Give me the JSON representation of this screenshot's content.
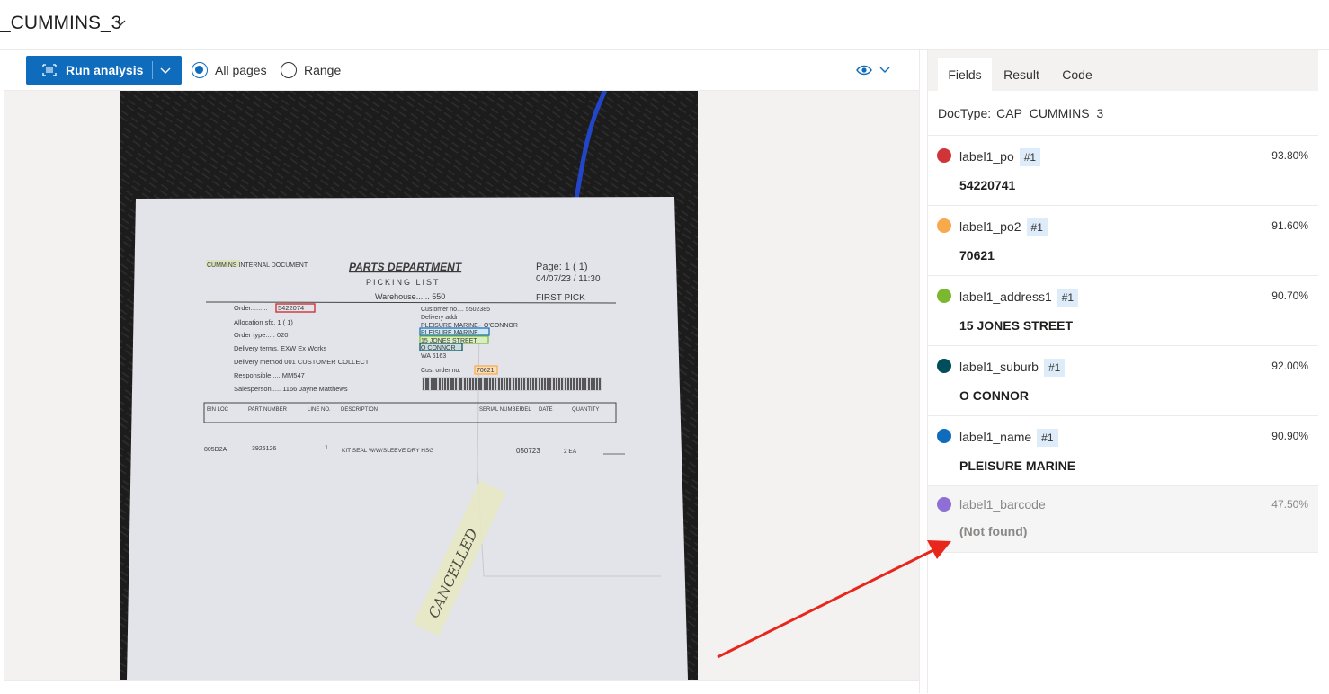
{
  "header": {
    "title": "_CUMMINS_3"
  },
  "toolbar": {
    "run_label": "Run analysis",
    "radio_all": "All pages",
    "radio_range": "Range"
  },
  "document": {
    "header_left": "CUMMINS INTERNAL DOCUMENT",
    "dept": "PARTS DEPARTMENT",
    "list": "PICKING LIST",
    "warehouse": "Warehouse...... 550",
    "page": "Page:  1  (  1)",
    "datetime": "04/07/23 / 11:30",
    "first_pick": "FIRST PICK",
    "order_label": "Order.........",
    "order_value": "5422074",
    "allocation": "Allocation sfx.  1 ( 1)",
    "order_type": "Order type..... 020",
    "delivery_terms": "Delivery terms. EXW Ex Works",
    "delivery_method": "Delivery method 001 CUSTOMER COLLECT",
    "responsible": "Responsible..... MM547",
    "salesperson": "Salesperson..... 1166 Jayne Matthews",
    "customer_no": "Customer no.... 5502385",
    "delivery_addr": "Delivery addr",
    "addr_line1": "PLEISURE MARINE - O'CONNOR",
    "addr_name": "PLEISURE MARINE",
    "addr_street": "15 JONES STREET",
    "addr_suburb": "O CONNOR",
    "addr_state": "WA 6163",
    "cust_order_label": "Cust order no.",
    "cust_order_value": "70621",
    "col_bin": "BIN LOC",
    "col_part": "PART NUMBER",
    "col_line": "LINE NO.",
    "col_desc": "DESCRIPTION",
    "col_serial": "SERIAL NUMBER",
    "col_del": "DEL",
    "col_date": "DATE",
    "col_qty": "QUANTITY",
    "row_bin": "805D2A",
    "row_part": "3926126",
    "row_line": "1",
    "row_desc": "KIT SEAL W/W/SLEEVE  DRY HSG",
    "row_serial": "050723",
    "row_qty": "2  EA",
    "handwriting": "CANCELLED"
  },
  "panel": {
    "tabs": [
      "Fields",
      "Result",
      "Code"
    ],
    "doctype_label": "DocType:",
    "doctype_value": "CAP_CUMMINS_3",
    "fields": [
      {
        "name": "label1_po",
        "badge": "#1",
        "confidence": "93.80%",
        "value": "54220741",
        "color": "#d13438"
      },
      {
        "name": "label1_po2",
        "badge": "#1",
        "confidence": "91.60%",
        "value": "70621",
        "color": "#f7a94b"
      },
      {
        "name": "label1_address1",
        "badge": "#1",
        "confidence": "90.70%",
        "value": "15 JONES STREET",
        "color": "#7cb82f"
      },
      {
        "name": "label1_suburb",
        "badge": "#1",
        "confidence": "92.00%",
        "value": "O CONNOR",
        "color": "#004e5a"
      },
      {
        "name": "label1_name",
        "badge": "#1",
        "confidence": "90.90%",
        "value": "PLEISURE MARINE",
        "color": "#0f6cbd"
      },
      {
        "name": "label1_barcode",
        "badge": "",
        "confidence": "47.50%",
        "value": "(Not found)",
        "color": "#8e6fd6"
      }
    ]
  },
  "colors": {
    "accent": "#0f6cbd",
    "annotation_arrow": "#e8261b"
  }
}
